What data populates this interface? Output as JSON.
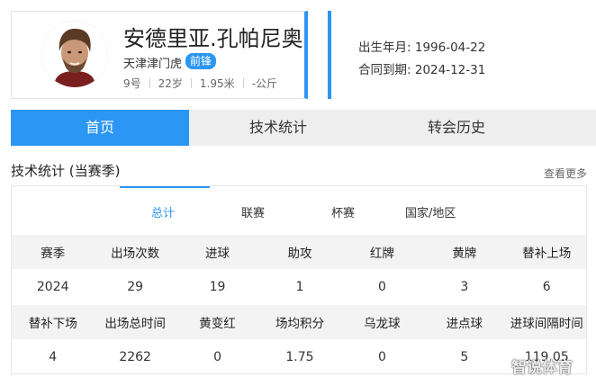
{
  "player": {
    "name": "安德里亚.孔帕尼奥",
    "club": "天津津门虎",
    "position": "前锋",
    "number": "9号",
    "age": "22岁",
    "height": "1.95米",
    "weight": "-公斤"
  },
  "info": {
    "birth_label": "出生年月:",
    "birth_value": "1996-04-22",
    "contract_label": "合同到期:",
    "contract_value": "2024-12-31"
  },
  "tabs": [
    {
      "label": "首页"
    },
    {
      "label": "技术统计"
    },
    {
      "label": "转会历史"
    }
  ],
  "section": {
    "title": "技术统计 (当赛季)",
    "more": "查看更多"
  },
  "subtabs": [
    {
      "label": "总计"
    },
    {
      "label": "联赛"
    },
    {
      "label": "杯赛"
    },
    {
      "label": "国家/地区"
    }
  ],
  "stats": {
    "row1_headers": [
      "赛季",
      "出场次数",
      "进球",
      "助攻",
      "红牌",
      "黄牌",
      "替补上场"
    ],
    "row1_values": [
      "2024",
      "29",
      "19",
      "1",
      "0",
      "3",
      "6"
    ],
    "row2_headers": [
      "替补下场",
      "出场总时间",
      "黄变红",
      "场均积分",
      "乌龙球",
      "进点球",
      "进球间隔时间"
    ],
    "row2_values": [
      "4",
      "2262",
      "0",
      "1.75",
      "0",
      "5",
      "119.05"
    ]
  },
  "watermark": "智说体育",
  "colors": {
    "accent": "#2b96f3",
    "tab_bg": "#eeeeee",
    "header_bg": "#f3f3f3"
  }
}
